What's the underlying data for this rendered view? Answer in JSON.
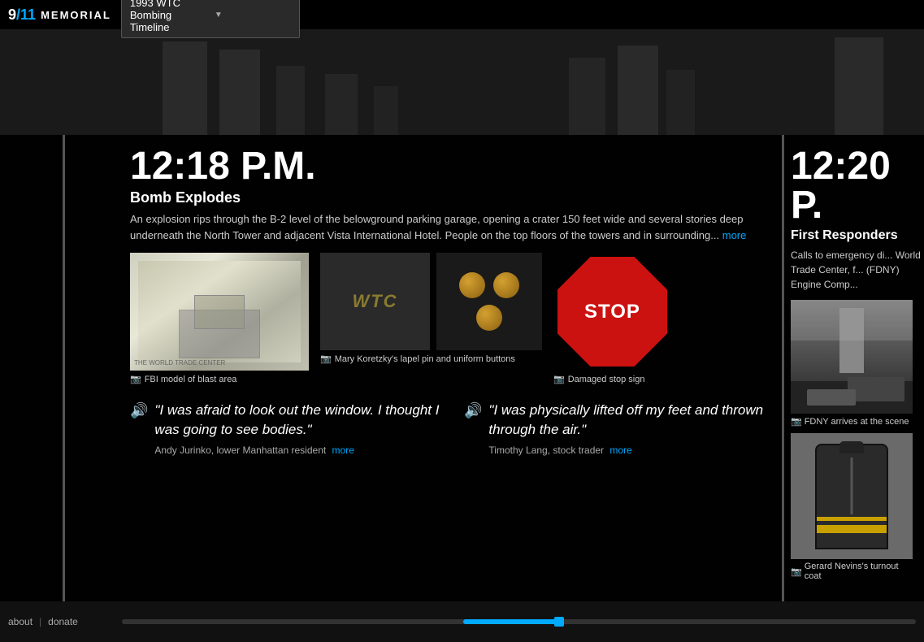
{
  "header": {
    "logo_nine": "9",
    "logo_slash": "/",
    "logo_eleven": "11",
    "logo_memorial": "MEMORIAL",
    "dropdown_label": "1993 WTC Bombing Timeline"
  },
  "timeline": {
    "sections": [
      {
        "id": "section-1218",
        "time": "12:18 P.M.",
        "title": "Bomb Explodes",
        "description": "An explosion rips through the B-2 level of the belowground parking garage, opening a crater 150 feet wide and several stories deep underneath the North Tower and adjacent Vista International Hotel. People on the top floors of the towers and in surrounding...",
        "more_link_text": "more",
        "images": [
          {
            "id": "fbi-model",
            "label": "FBI model of blast area",
            "type": "photo"
          },
          {
            "id": "wtc-pin",
            "label": "Mary Koretzky's lapel pin and uniform buttons",
            "type": "photo"
          },
          {
            "id": "stop-sign",
            "label": "Damaged stop sign",
            "type": "photo"
          }
        ],
        "quotes": [
          {
            "id": "quote-1",
            "text": "\"I was afraid to look out the window. I thought I was going to see bodies.\"",
            "attribution": "Andy Jurinko, lower Manhattan resident",
            "has_audio": true,
            "more_link_text": "more"
          },
          {
            "id": "quote-2",
            "text": "\"I was physically lifted off my feet and thrown through the air.\"",
            "attribution": "Timothy Lang, stock trader",
            "has_audio": true,
            "more_link_text": "more"
          }
        ]
      },
      {
        "id": "section-1220",
        "time": "12:20 P.",
        "title": "First Responders",
        "description": "Calls to emergency di... World Trade Center, f... (FDNY) Engine Comp...",
        "images": [
          {
            "id": "fdny-arrives",
            "label": "FDNY arrives at the scene",
            "type": "photo"
          },
          {
            "id": "turnout-coat",
            "label": "Gerard Nevins's turnout coat",
            "type": "object"
          }
        ]
      }
    ]
  },
  "footer": {
    "about_label": "about",
    "donate_label": "donate",
    "divider": "|",
    "scrubber_position_percent": 43,
    "scrubber_fill_percent": 12
  },
  "icons": {
    "camera": "📷",
    "audio": "🔊",
    "dropdown_arrow": "▼"
  }
}
